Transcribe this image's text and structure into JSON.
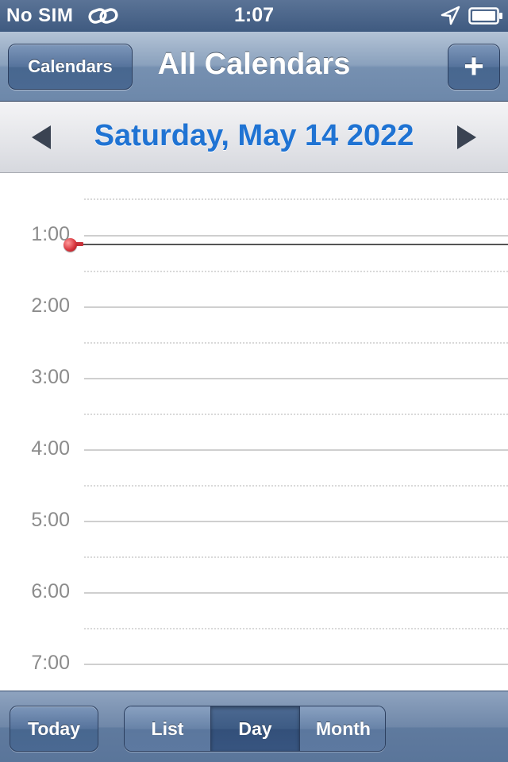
{
  "status_bar": {
    "carrier": "No SIM",
    "time": "1:07",
    "icons": [
      "link-icon",
      "location-arrow-icon",
      "battery-icon"
    ]
  },
  "nav_bar": {
    "left_button": "Calendars",
    "title": "All Calendars",
    "right_button": "+"
  },
  "date_bar": {
    "label": "Saturday, May 14 2022",
    "prev_icon": "triangle-left-icon",
    "next_icon": "triangle-right-icon"
  },
  "day_view": {
    "hours": [
      {
        "label": "1:00"
      },
      {
        "label": "2:00"
      },
      {
        "label": "3:00"
      },
      {
        "label": "4:00"
      },
      {
        "label": "5:00"
      },
      {
        "label": "6:00"
      },
      {
        "label": "7:00"
      }
    ],
    "current_time_indicator": "1:07"
  },
  "toolbar": {
    "today_label": "Today",
    "segments": [
      {
        "label": "List",
        "selected": false
      },
      {
        "label": "Day",
        "selected": true
      },
      {
        "label": "Month",
        "selected": false
      }
    ]
  },
  "colors": {
    "accent_date": "#1f73d3",
    "nav_bar": "#7690b1",
    "current_time_pin": "#d5323a",
    "hour_label": "#8c8c8c"
  }
}
